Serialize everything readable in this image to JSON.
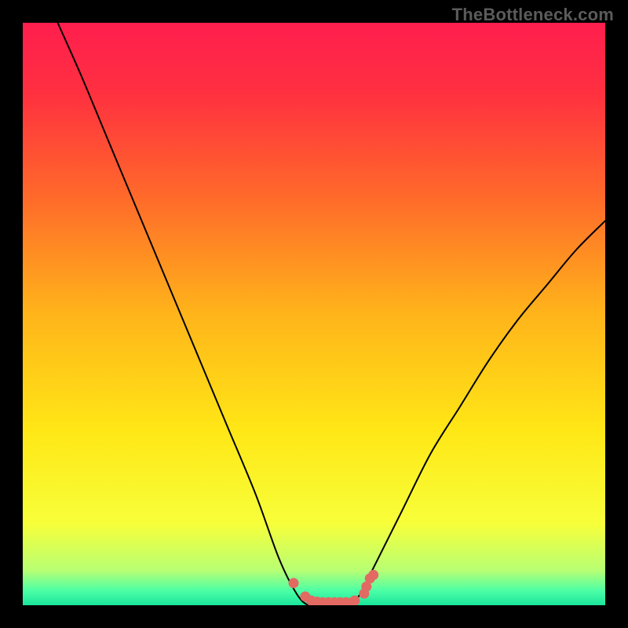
{
  "watermark": {
    "text": "TheBottleneck.com"
  },
  "chart_data": {
    "type": "line",
    "title": "",
    "xlabel": "",
    "ylabel": "",
    "xlim": [
      0,
      100
    ],
    "ylim": [
      0,
      100
    ],
    "grid": false,
    "legend": false,
    "background_gradient_stops": [
      {
        "pos": 0.0,
        "color": "#ff1e4e"
      },
      {
        "pos": 0.12,
        "color": "#ff3040"
      },
      {
        "pos": 0.3,
        "color": "#ff6a2a"
      },
      {
        "pos": 0.5,
        "color": "#ffb41a"
      },
      {
        "pos": 0.7,
        "color": "#ffe716"
      },
      {
        "pos": 0.86,
        "color": "#f7ff3a"
      },
      {
        "pos": 0.94,
        "color": "#b8ff73"
      },
      {
        "pos": 0.975,
        "color": "#4dffa6"
      },
      {
        "pos": 1.0,
        "color": "#19e59b"
      }
    ],
    "series": [
      {
        "name": "bottleneck-curve",
        "x": [
          6,
          10,
          15,
          20,
          25,
          30,
          35,
          40,
          44,
          47,
          49,
          51,
          54,
          56,
          58,
          60,
          65,
          70,
          75,
          80,
          85,
          90,
          95,
          100
        ],
        "y": [
          100,
          91,
          79,
          67,
          55,
          43,
          31,
          19,
          8,
          2,
          0,
          0,
          0,
          0,
          2,
          6,
          16,
          26,
          34,
          42,
          49,
          55,
          61,
          66
        ]
      }
    ],
    "markers": {
      "name": "optimal-range-dots",
      "color": "#e26a63",
      "x": [
        46.5,
        48.5,
        49.5,
        50.5,
        51.5,
        52.5,
        53.5,
        54.5,
        55.5,
        56.5,
        57.0,
        58.6,
        59.0,
        59.6,
        60.2
      ],
      "y": [
        3.8,
        1.5,
        0.8,
        0.6,
        0.5,
        0.5,
        0.5,
        0.5,
        0.5,
        0.5,
        0.8,
        2.0,
        3.2,
        4.6,
        5.2
      ]
    }
  }
}
